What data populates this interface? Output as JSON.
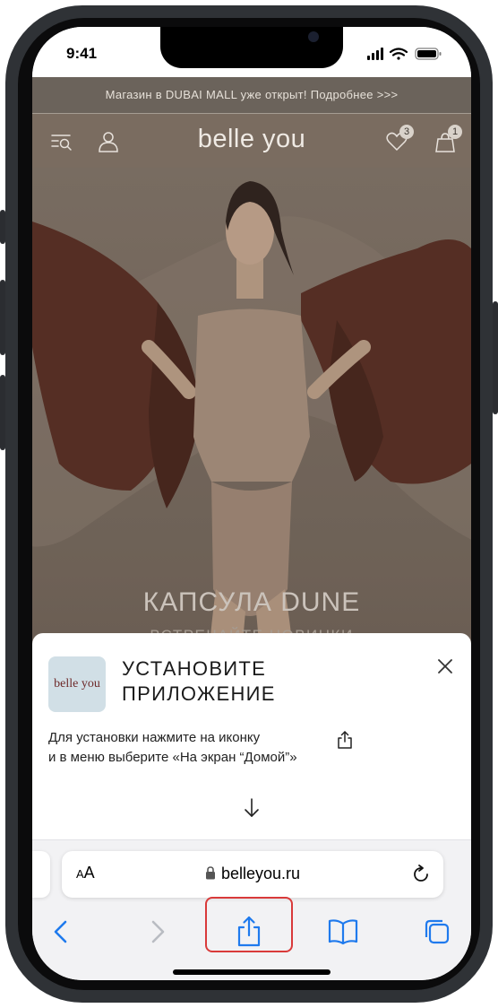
{
  "status_bar": {
    "time": "9:41"
  },
  "website": {
    "promo_banner": "Магазин в DUBAI MALL уже открыт! Подробнее >>>",
    "logo": "belle you",
    "wishlist_count": "3",
    "cart_count": "1",
    "hero": {
      "title": "КАПСУЛА DUNE",
      "subtitle": "ВСТРЕЧАЙТЕ НОВИНКИ"
    }
  },
  "install_prompt": {
    "app_icon_text": "belle you",
    "title_line1": "УСТАНОВИТЕ",
    "title_line2": "ПРИЛОЖЕНИЕ",
    "instruction_line1": "Для установки нажмите на иконку",
    "instruction_line2": "и в меню выберите «На экран “Домой”»"
  },
  "safari": {
    "aa_big": "A",
    "aa_small": "A",
    "url": "belleyou.ru"
  },
  "colors": {
    "highlight": "#d93a3a",
    "ios_blue": "#1f7aed",
    "app_icon_bg": "#d1dfe6",
    "brand_text": "#6e2a2a"
  },
  "icons": [
    "menu-search-icon",
    "profile-icon",
    "heart-icon",
    "bag-icon",
    "close-icon",
    "share-icon",
    "arrow-down-icon",
    "lock-icon",
    "reload-icon",
    "back-icon",
    "forward-icon",
    "bookmarks-icon",
    "tabs-icon"
  ]
}
